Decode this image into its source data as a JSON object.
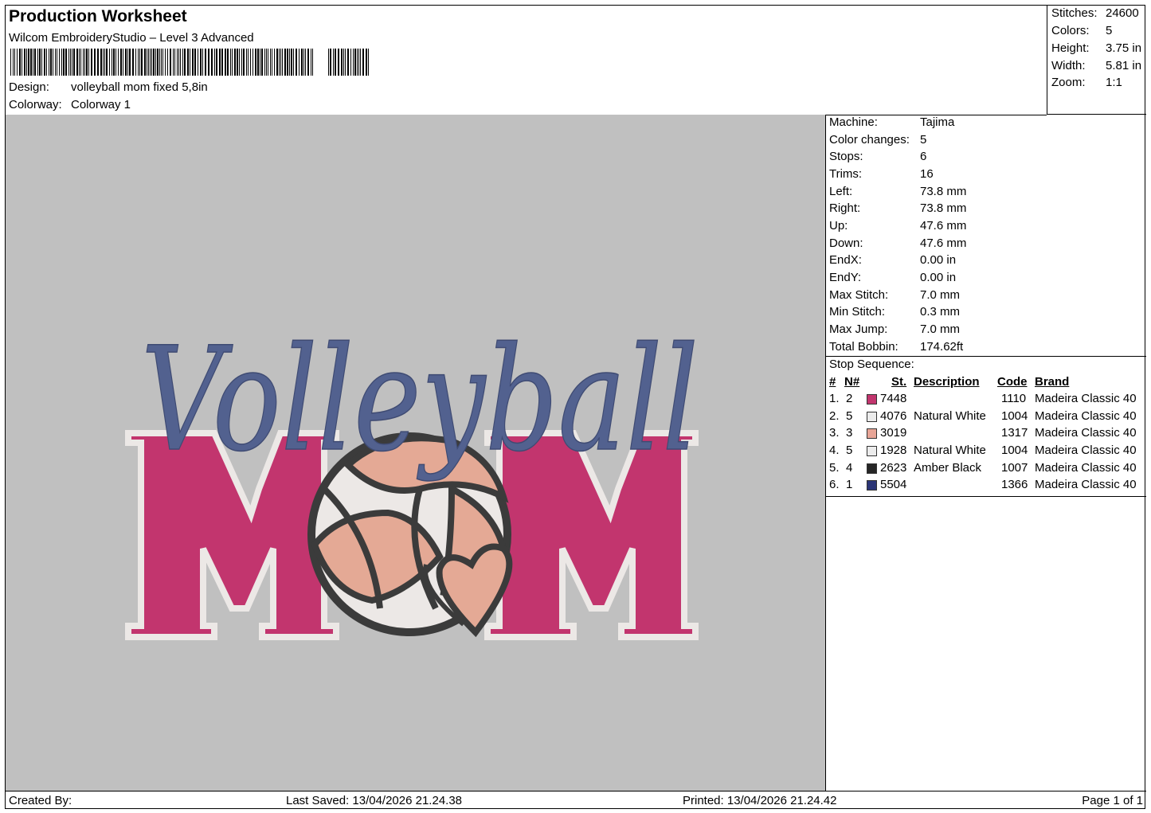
{
  "header": {
    "title": "Production Worksheet",
    "subtitle": "Wilcom EmbroideryStudio – Level 3 Advanced",
    "design_label": "Design:",
    "design_value": "volleyball mom fixed 5,8in",
    "colorway_label": "Colorway:",
    "colorway_value": "Colorway 1"
  },
  "stats": [
    {
      "label": "Stitches:",
      "value": "24600"
    },
    {
      "label": "Colors:",
      "value": "5"
    },
    {
      "label": "Height:",
      "value": "3.75 in"
    },
    {
      "label": "Width:",
      "value": "5.81 in"
    },
    {
      "label": "Zoom:",
      "value": "1:1"
    }
  ],
  "design": {
    "script_text": "Volleyball",
    "block_text": "M",
    "block_text_2": "M",
    "colors": {
      "background": "#c0c0c0",
      "pink": "#c2356e",
      "white": "#ece8e6",
      "salmon": "#e4a995",
      "black": "#3b3b3b",
      "navy": "#52618f"
    }
  },
  "machine_info": [
    {
      "label": "Machine:",
      "value": "Tajima"
    },
    {
      "label": "Color changes:",
      "value": "5"
    },
    {
      "label": "Stops:",
      "value": "6"
    },
    {
      "label": "Trims:",
      "value": "16"
    },
    {
      "label": "Left:",
      "value": "73.8 mm"
    },
    {
      "label": "Right:",
      "value": "73.8 mm"
    },
    {
      "label": "Up:",
      "value": "47.6 mm"
    },
    {
      "label": "Down:",
      "value": "47.6 mm"
    },
    {
      "label": "EndX:",
      "value": "0.00 in"
    },
    {
      "label": "EndY:",
      "value": "0.00 in"
    },
    {
      "label": "Max Stitch:",
      "value": "7.0 mm"
    },
    {
      "label": "Min Stitch:",
      "value": "0.3 mm"
    },
    {
      "label": "Max Jump:",
      "value": "7.0 mm"
    },
    {
      "label": "Total Bobbin:",
      "value": "174.62ft"
    }
  ],
  "stop_sequence": {
    "title": "Stop Sequence:",
    "headers": {
      "num": "#",
      "n": "N#",
      "st": "St.",
      "description": "Description",
      "code": "Code",
      "brand": "Brand"
    },
    "rows": [
      {
        "num": "1.",
        "n": "2",
        "color": "#c2356e",
        "st": "7448",
        "description": "",
        "code": "1110",
        "brand": "Madeira Classic 40"
      },
      {
        "num": "2.",
        "n": "5",
        "color": "#ececec",
        "st": "4076",
        "description": "Natural White",
        "code": "1004",
        "brand": "Madeira Classic 40"
      },
      {
        "num": "3.",
        "n": "3",
        "color": "#e8a597",
        "st": "3019",
        "description": "",
        "code": "1317",
        "brand": "Madeira Classic 40"
      },
      {
        "num": "4.",
        "n": "5",
        "color": "#ececec",
        "st": "1928",
        "description": "Natural White",
        "code": "1004",
        "brand": "Madeira Classic 40"
      },
      {
        "num": "5.",
        "n": "4",
        "color": "#262626",
        "st": "2623",
        "description": "Amber Black",
        "code": "1007",
        "brand": "Madeira Classic 40"
      },
      {
        "num": "6.",
        "n": "1",
        "color": "#2b3576",
        "st": "5504",
        "description": "",
        "code": "1366",
        "brand": "Madeira Classic 40"
      }
    ]
  },
  "footer": {
    "created_by": "Created By:",
    "last_saved": "Last Saved: 13/04/2026 21.24.38",
    "printed": "Printed: 13/04/2026 21.24.42",
    "page": "Page 1 of 1"
  }
}
